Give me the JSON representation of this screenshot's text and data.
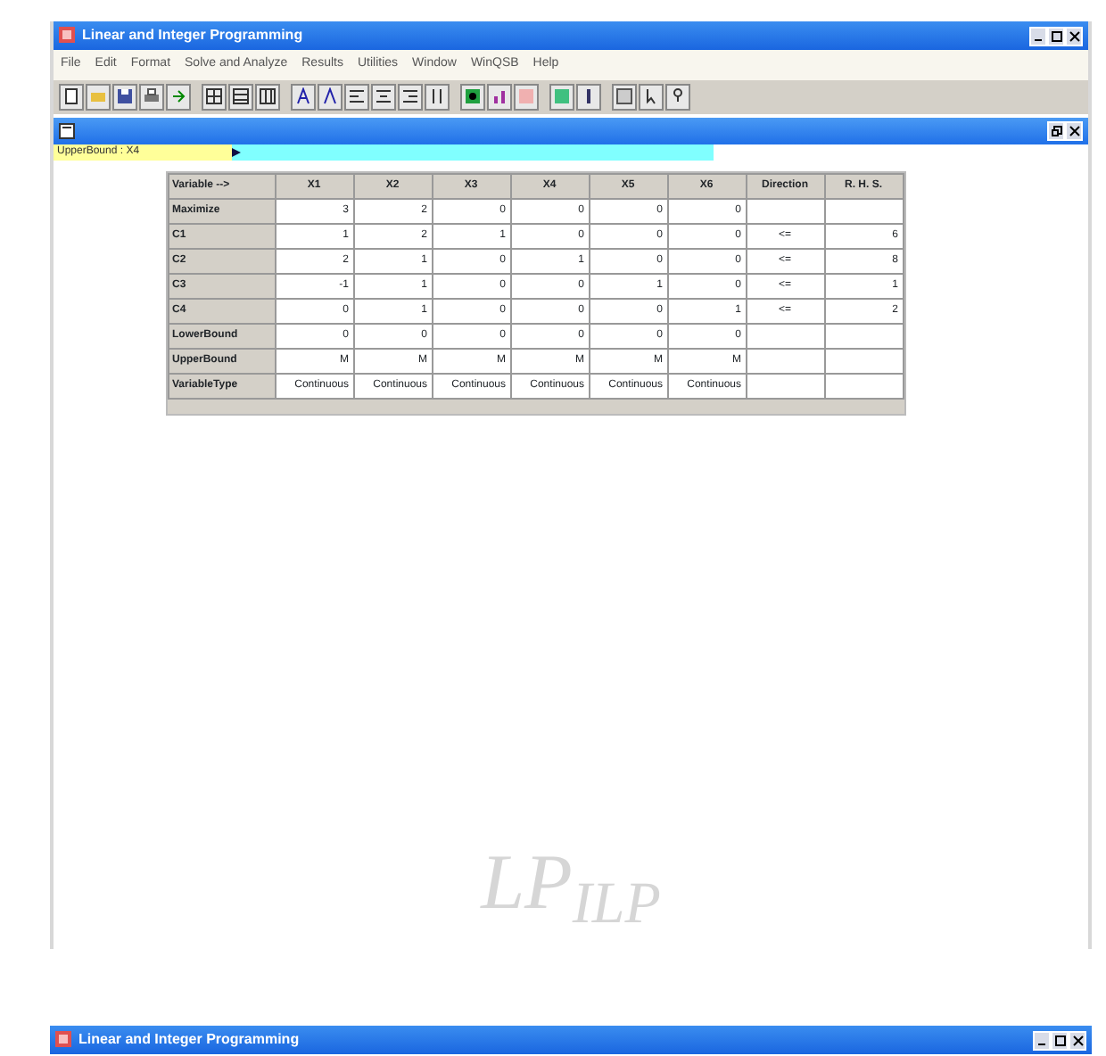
{
  "window": {
    "title": "Linear and Integer Programming"
  },
  "menu": [
    "File",
    "Edit",
    "Format",
    "Solve and Analyze",
    "Results",
    "Utilities",
    "Window",
    "WinQSB",
    "Help"
  ],
  "editor": {
    "cell_indicator": "UpperBound : X4"
  },
  "table": {
    "columns": [
      "Variable -->",
      "X1",
      "X2",
      "X3",
      "X4",
      "X5",
      "X6",
      "Direction",
      "R. H. S."
    ],
    "rows": [
      {
        "cells": [
          "Maximize",
          "3",
          "2",
          "0",
          "0",
          "0",
          "0",
          "",
          ""
        ]
      },
      {
        "cells": [
          "C1",
          "1",
          "2",
          "1",
          "0",
          "0",
          "0",
          "<=",
          "6"
        ]
      },
      {
        "cells": [
          "C2",
          "2",
          "1",
          "0",
          "1",
          "0",
          "0",
          "<=",
          "8"
        ]
      },
      {
        "cells": [
          "C3",
          "-1",
          "1",
          "0",
          "0",
          "1",
          "0",
          "<=",
          "1"
        ]
      },
      {
        "cells": [
          "C4",
          "0",
          "1",
          "0",
          "0",
          "0",
          "1",
          "<=",
          "2"
        ]
      },
      {
        "cells": [
          "LowerBound",
          "0",
          "0",
          "0",
          "0",
          "0",
          "0",
          "",
          ""
        ]
      },
      {
        "cells": [
          "UpperBound",
          "M",
          "M",
          "M",
          "M",
          "M",
          "M",
          "",
          ""
        ]
      },
      {
        "cells": [
          "VariableType",
          "Continuous",
          "Continuous",
          "Continuous",
          "Continuous",
          "Continuous",
          "Continuous",
          "",
          ""
        ]
      }
    ]
  },
  "logo": "LP$_{ILP}$",
  "second_window": {
    "title": "Linear and Integer Programming"
  }
}
